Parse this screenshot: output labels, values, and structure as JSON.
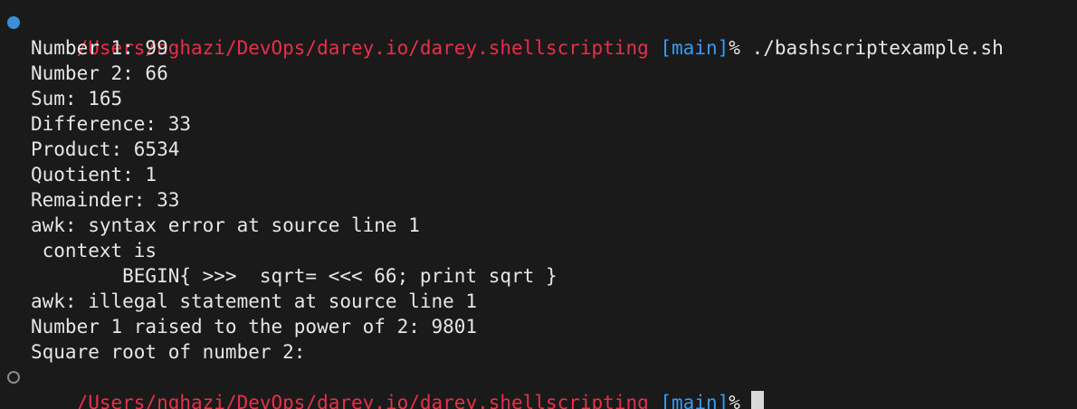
{
  "prompt": {
    "path": "/Users/nghazi/DevOps/darey.io/darey.shellscripting",
    "branch": "[main]",
    "symbol": "%",
    "command": "./bashscriptexample.sh"
  },
  "output": [
    "Number 1: 99",
    "Number 2: 66",
    "Sum: 165",
    "Difference: 33",
    "Product: 6534",
    "Quotient: 1",
    "Remainder: 33",
    "awk: syntax error at source line 1",
    " context is",
    "        BEGIN{ >>>  sqrt= <<< 66; print sqrt }",
    "awk: illegal statement at source line 1",
    "Number 1 raised to the power of 2: 9801",
    "Square root of number 2:"
  ],
  "colors": {
    "background": "#1a1a1a",
    "path": "#e5304a",
    "branch": "#3a9af0",
    "text": "#e6e6e6",
    "marker_active": "#3d8ed6"
  }
}
